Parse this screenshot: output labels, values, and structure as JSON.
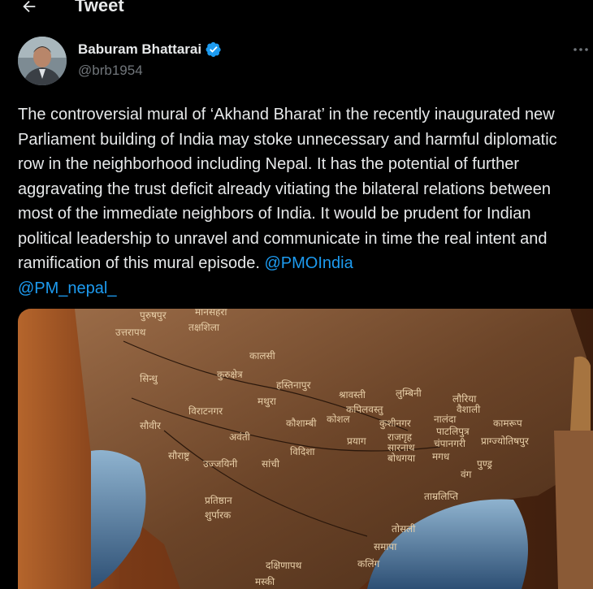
{
  "header": {
    "title": "Tweet"
  },
  "author": {
    "name": "Baburam Bhattarai",
    "handle": "@brb1954"
  },
  "tweet": {
    "text": "The controversial mural of ‘Akhand  Bharat’ in the recently inaugurated new Parliament building of India may stoke unnecessary and harmful diplomatic row in the neighborhood including Nepal. It has the potential of further aggravating the trust deficit already vitiating the bilateral relations between most of the immediate neighbors of India. It would be prudent for Indian political leadership to unravel and communicate in time the real intent and ramification of this mural episode. ",
    "mentions": [
      "@PMOIndia",
      "@PM_nepal_"
    ]
  },
  "mural": {
    "labels": [
      "पुरुषपुर",
      "मानसहरा",
      "उत्तरापथ",
      "तक्षशिला",
      "कालसी",
      "सिन्धु",
      "कुरुक्षेत्र",
      "हस्तिनापुर",
      "श्रावस्ती",
      "लुम्बिनी",
      "लौरिया",
      "कपिलवस्तु",
      "वैशाली",
      "मथुरा",
      "कोशल",
      "विराटनगर",
      "कुशीनगर",
      "नालंदा",
      "कामरूप",
      "सौवीर",
      "कौशाम्बी",
      "पाटलिपुत्र",
      "राजगृह",
      "चंपानगरी",
      "प्राग्ज्योतिषपुर",
      "प्रयाग",
      "सारनाथ",
      "अवंती",
      "बोधगया",
      "मगध",
      "सौराष्ट्र",
      "विदिशा",
      "उज्जयिनी",
      "सांची",
      "पुण्ड्र",
      "वंग",
      "ताम्रलिप्ति",
      "प्रतिष्ठान",
      "शुर्पारक",
      "तोसली",
      "समापा",
      "दक्षिणापथ",
      "कलिंग",
      "मस्की"
    ]
  },
  "colors": {
    "accent": "#1d9bf0",
    "background": "#000000",
    "text": "#e7e9ea",
    "muted": "#71767b"
  },
  "icons": {
    "back": "arrow-left-icon",
    "verified": "verified-badge-icon",
    "more": "more-horizontal-icon"
  }
}
